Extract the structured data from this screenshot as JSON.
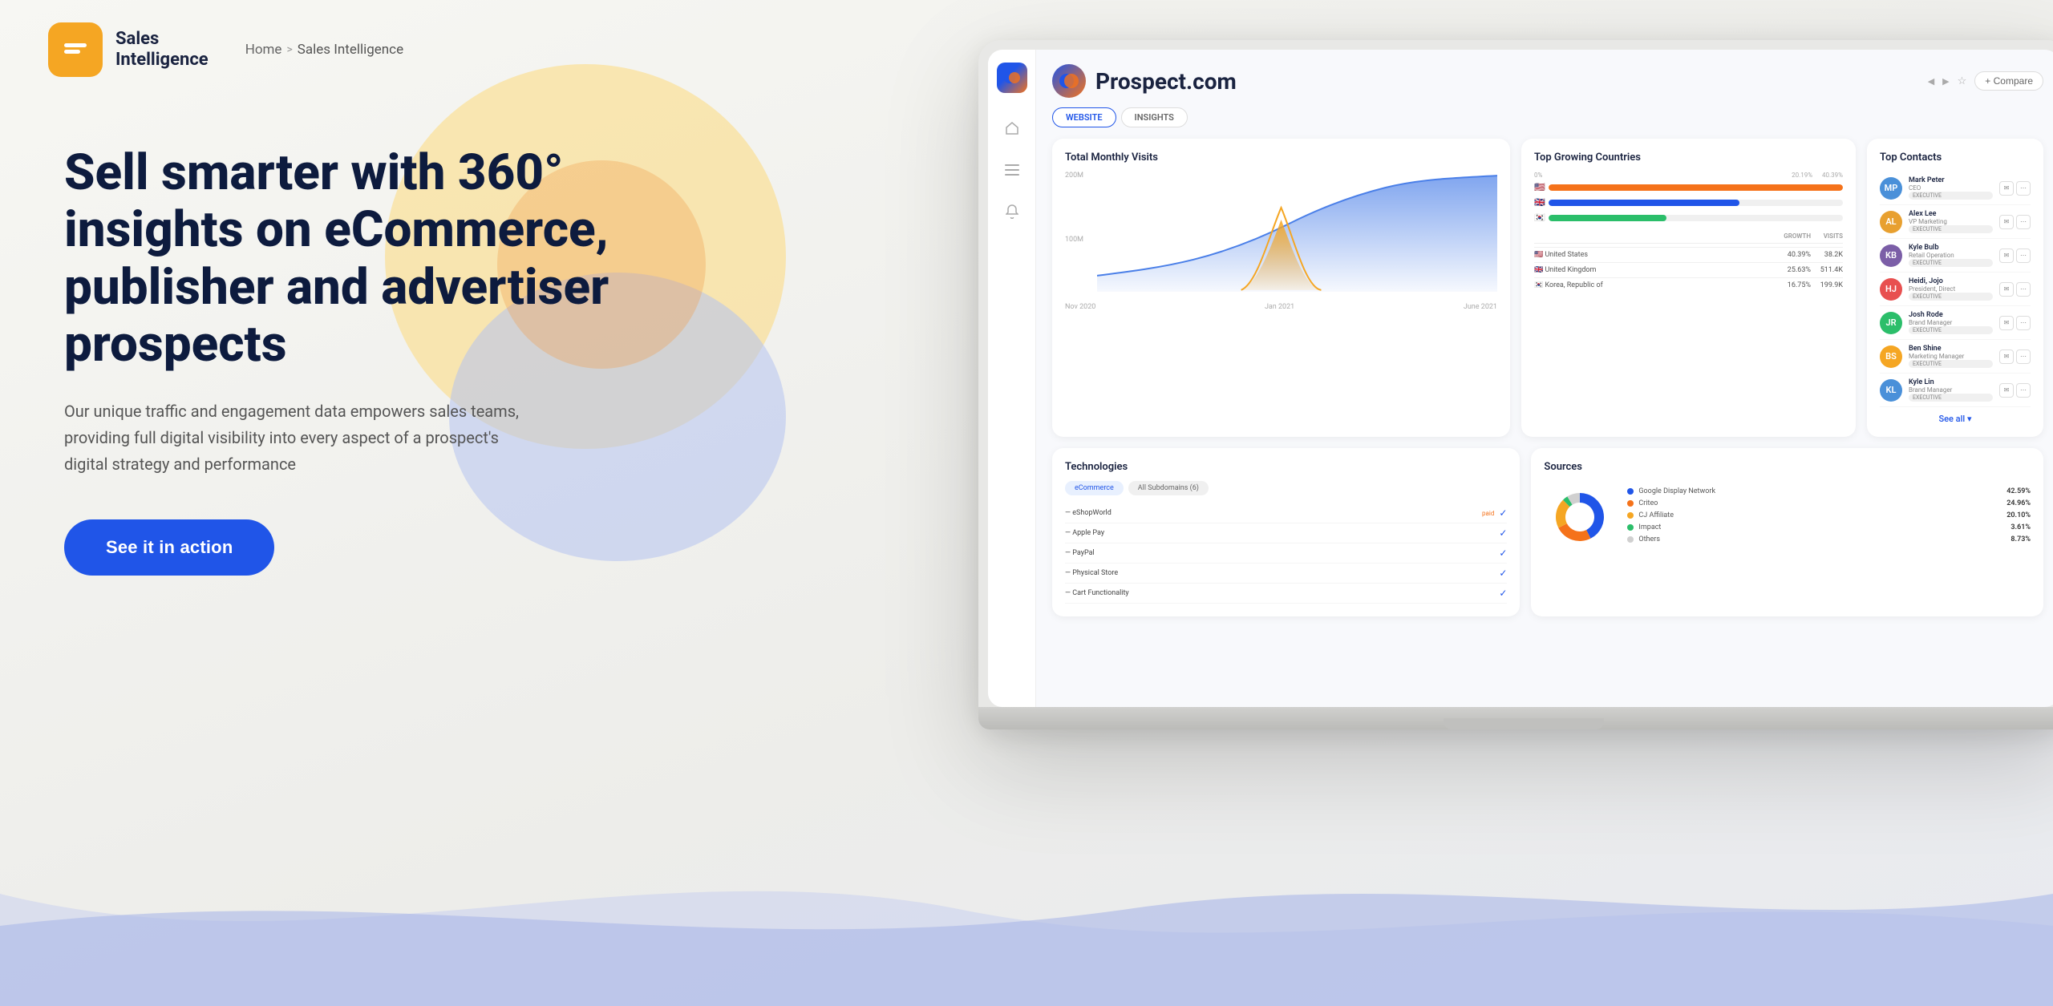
{
  "page": {
    "bg_color": "#f4f4f0"
  },
  "header": {
    "logo_text1": "Sales",
    "logo_text2": "Intelligence",
    "breadcrumb_home": "Home",
    "breadcrumb_sep": ">",
    "breadcrumb_current": "Sales Intelligence"
  },
  "hero": {
    "title": "Sell smarter with 360° insights on eCommerce, publisher and advertiser prospects",
    "description": "Our unique traffic and engagement data empowers sales teams, providing full digital visibility into every aspect of a prospect's digital strategy and performance",
    "cta_label": "See it in action"
  },
  "dashboard": {
    "domain_name": "Prospect.com",
    "tabs": [
      "WEBSITE",
      "INSIGHTS"
    ],
    "active_tab": "WEBSITE",
    "actions": [
      "+ Compare"
    ],
    "traffic": {
      "title": "Total Monthly Visits",
      "y_labels": [
        "200M",
        "100M"
      ],
      "x_labels": [
        "Nov 2020",
        "Jan 2021",
        "June 2021"
      ]
    },
    "countries": {
      "title": "Top Growing Countries",
      "bars": [
        {
          "flag": "🇺🇸",
          "pct_label": "0%",
          "pct_right": "20.19%",
          "pct_far": "40.39%",
          "color1": "#2055e8",
          "color2": "#f5721a",
          "width1": "50%",
          "width2": "100%"
        },
        {
          "flag": "🇬🇧",
          "color": "#2055e8",
          "width": "65%"
        },
        {
          "flag": "🇰🇷",
          "color": "#2bbe6a",
          "width": "40%"
        }
      ],
      "table_headers": {
        "country": "",
        "growth": "GROWTH",
        "visits": "VISITS"
      },
      "rows": [
        {
          "flag": "🇺🇸",
          "name": "United States",
          "growth": "40.39%",
          "visits": "38.2K"
        },
        {
          "flag": "🇬🇧",
          "name": "United Kingdom",
          "growth": "25.63%",
          "visits": "511.4K"
        },
        {
          "flag": "🇰🇷",
          "name": "Korea, Republic of",
          "growth": "16.75%",
          "visits": "199.9K"
        }
      ]
    },
    "contacts": {
      "title": "Top Contacts",
      "see_all": "See all",
      "items": [
        {
          "initials": "MP",
          "color": "#4a90d9",
          "name": "Mark Peter",
          "role": "CEO",
          "badge": "EXECUTIVE"
        },
        {
          "initials": "AL",
          "color": "#e8a030",
          "name": "Alex Lee",
          "role": "VP Marketing",
          "badge": "EXECUTIVE"
        },
        {
          "initials": "KB",
          "color": "#7b5ea7",
          "name": "Kyle Bulb",
          "role": "Retail Operation",
          "badge": "EXECUTIVE"
        },
        {
          "initials": "HJ",
          "color": "#e85050",
          "name": "Heidi, Jojo",
          "role": "President, Direct",
          "badge": "EXECUTIVE"
        },
        {
          "initials": "JR",
          "color": "#2bbe6a",
          "name": "Josh Rode",
          "role": "Brand Manager",
          "badge": "EXECUTIVE"
        },
        {
          "initials": "BS",
          "color": "#f5a623",
          "name": "Ben Shine",
          "role": "Marketing Manager",
          "badge": "EXECUTIVE"
        },
        {
          "initials": "KL",
          "color": "#4a90d9",
          "name": "Kyle Lin",
          "role": "Brand Manager",
          "badge": "EXECUTIVE"
        }
      ]
    },
    "technologies": {
      "title": "Technologies",
      "tabs": [
        "eCommerce",
        "All Subdomains (6)"
      ],
      "items": [
        {
          "name": "eShopWorld",
          "badge": "paid",
          "checked": true
        },
        {
          "name": "Apple Pay",
          "badge": "",
          "checked": true
        },
        {
          "name": "PayPal",
          "badge": "",
          "checked": true
        },
        {
          "name": "Physical Store",
          "badge": "",
          "checked": true
        },
        {
          "name": "Cart Functionality",
          "badge": "",
          "checked": true
        }
      ]
    },
    "sources": {
      "title": "Sources",
      "legend": [
        {
          "label": "Google Display Network",
          "color": "#2055e8",
          "pct": "42.59%"
        },
        {
          "label": "Criteo",
          "color": "#f5721a",
          "pct": "24.96%"
        },
        {
          "label": "CJ Affiliate",
          "color": "#f5a623",
          "pct": "20.10%"
        },
        {
          "label": "Impact",
          "color": "#2bbe6a",
          "pct": "3.61%"
        },
        {
          "label": "Others",
          "color": "#d0d0d0",
          "pct": "8.73%"
        }
      ],
      "donut": {
        "segments": [
          {
            "pct": 42.59,
            "color": "#2055e8"
          },
          {
            "pct": 24.96,
            "color": "#f5721a"
          },
          {
            "pct": 20.1,
            "color": "#f5a623"
          },
          {
            "pct": 3.61,
            "color": "#2bbe6a"
          },
          {
            "pct": 8.74,
            "color": "#d0d0d0"
          }
        ]
      }
    }
  }
}
